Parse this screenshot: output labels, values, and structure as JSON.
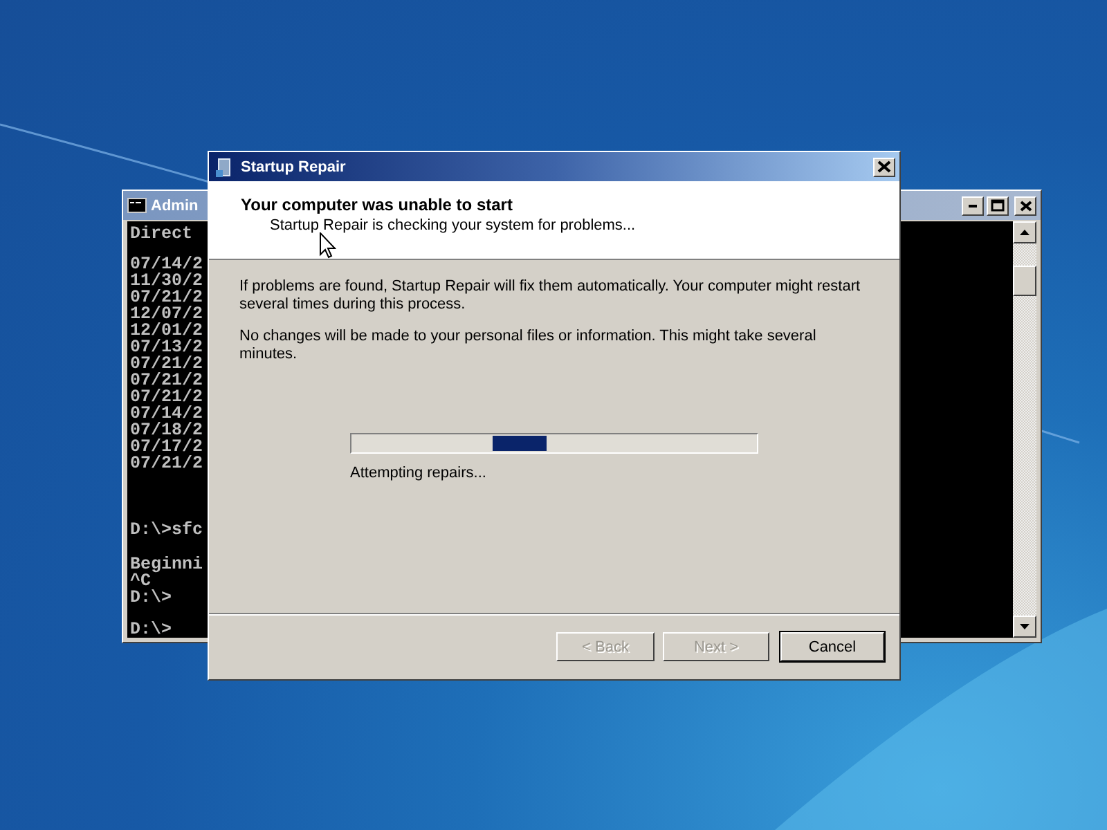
{
  "console_window": {
    "title": "Admin",
    "blocks": [
      [
        "Direct"
      ],
      [
        "07/14/2",
        "11/30/2",
        "07/21/2",
        "12/07/2",
        "12/01/2",
        "07/13/2",
        "07/21/2",
        "07/21/2",
        "07/21/2",
        "07/14/2",
        "07/18/2",
        "07/17/2",
        "07/21/2"
      ],
      [
        "D:\\>sfc"
      ],
      [
        "Beginni",
        "^C",
        "D:\\>"
      ],
      [
        "D:\\>"
      ]
    ]
  },
  "dialog": {
    "title": "Startup Repair",
    "heading": "Your computer was unable to start",
    "subheading": "Startup Repair is checking your system for problems...",
    "paragraphs": [
      "If problems are found, Startup Repair will fix them automatically. Your computer might restart several times during this process.",
      "No changes will be made to your personal files or information. This might take several minutes."
    ],
    "progress": {
      "indeterminate": true
    },
    "status": "Attempting repairs...",
    "buttons": [
      {
        "label": "< Back",
        "disabled": true,
        "default": false
      },
      {
        "label": "Next >",
        "disabled": true,
        "default": false
      },
      {
        "label": "Cancel",
        "disabled": false,
        "default": true
      }
    ]
  }
}
